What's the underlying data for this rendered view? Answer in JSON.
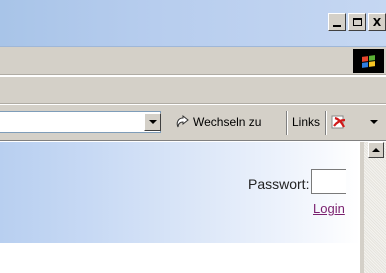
{
  "window": {
    "controls": {
      "minimize": "_",
      "maximize": "□",
      "close": "X"
    }
  },
  "address_bar": {
    "value": "",
    "go_label": "Wechseln zu",
    "links_label": "Links"
  },
  "content": {
    "password_label": "Passwort:",
    "password_value": "",
    "login_link": "Login"
  },
  "colors": {
    "titlebar": "#b7cdee",
    "chrome": "#d4d0c8",
    "link_visited": "#7a1f6e"
  },
  "icons": {
    "window_logo": "windows-flag-icon",
    "go": "go-arrow-icon",
    "toolbar_ext": "pdf-icon",
    "chevron": "chevron-down-icon"
  }
}
